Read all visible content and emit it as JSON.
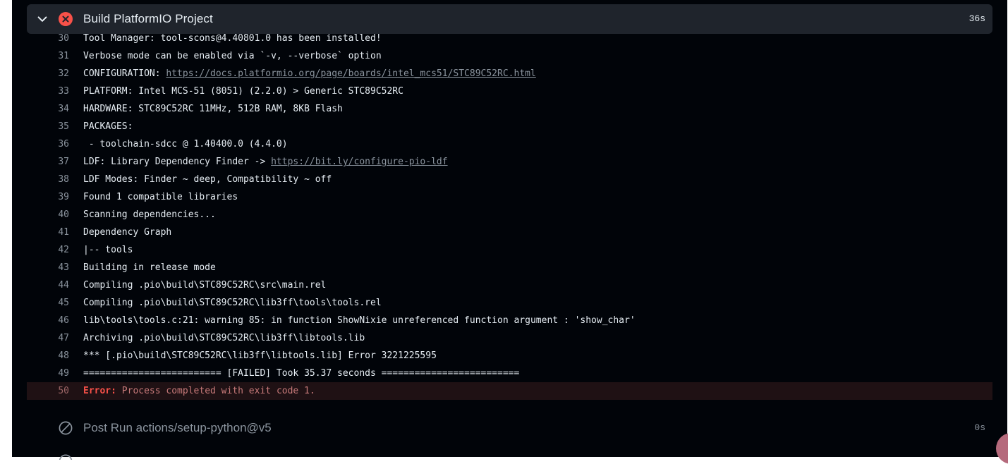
{
  "step": {
    "title": "Build PlatformIO Project",
    "duration": "36s",
    "status": "failed",
    "status_color": "#f85149"
  },
  "log_lines": [
    {
      "num": "30",
      "text": "Tool Manager: tool-scons@4.40801.0 has been installed!"
    },
    {
      "num": "31",
      "text": "Verbose mode can be enabled via `-v, --verbose` option"
    },
    {
      "num": "32",
      "prefix": "CONFIGURATION: ",
      "link": "https://docs.platformio.org/page/boards/intel_mcs51/STC89C52RC.html"
    },
    {
      "num": "33",
      "text": "PLATFORM: Intel MCS-51 (8051) (2.2.0) > Generic STC89C52RC"
    },
    {
      "num": "34",
      "text": "HARDWARE: STC89C52RC 11MHz, 512B RAM, 8KB Flash"
    },
    {
      "num": "35",
      "text": "PACKAGES:"
    },
    {
      "num": "36",
      "text": " - toolchain-sdcc @ 1.40400.0 (4.4.0)"
    },
    {
      "num": "37",
      "prefix": "LDF: Library Dependency Finder -> ",
      "link": "https://bit.ly/configure-pio-ldf"
    },
    {
      "num": "38",
      "text": "LDF Modes: Finder ~ deep, Compatibility ~ off"
    },
    {
      "num": "39",
      "text": "Found 1 compatible libraries"
    },
    {
      "num": "40",
      "text": "Scanning dependencies..."
    },
    {
      "num": "41",
      "text": "Dependency Graph"
    },
    {
      "num": "42",
      "text": "|-- tools"
    },
    {
      "num": "43",
      "text": "Building in release mode"
    },
    {
      "num": "44",
      "text": "Compiling .pio\\build\\STC89C52RC\\src\\main.rel"
    },
    {
      "num": "45",
      "text": "Compiling .pio\\build\\STC89C52RC\\lib3ff\\tools\\tools.rel"
    },
    {
      "num": "46",
      "text": "lib\\tools\\tools.c:21: warning 85: in function ShowNixie unreferenced function argument : 'show_char'"
    },
    {
      "num": "47",
      "text": "Archiving .pio\\build\\STC89C52RC\\lib3ff\\libtools.lib"
    },
    {
      "num": "48",
      "text": "*** [.pio\\build\\STC89C52RC\\lib3ff\\libtools.lib] Error 3221225595"
    },
    {
      "num": "49",
      "text": "========================= [FAILED] Took 35.37 seconds ========================="
    }
  ],
  "error_line": {
    "num": "50",
    "label": "Error:",
    "message": " Process completed with exit code 1."
  },
  "post_step": {
    "title": "Post Run actions/setup-python@v5",
    "duration": "0s",
    "status": "skipped"
  },
  "icons": {
    "collapse": "chevron-down-icon",
    "failed": "x-circle-fill-icon",
    "skipped": "skip-circle-icon"
  },
  "colors": {
    "background": "#010409",
    "header_bg": "#1f242c",
    "error_bg": "#1f1114",
    "muted": "#8b949e",
    "text": "#e6edf3"
  }
}
